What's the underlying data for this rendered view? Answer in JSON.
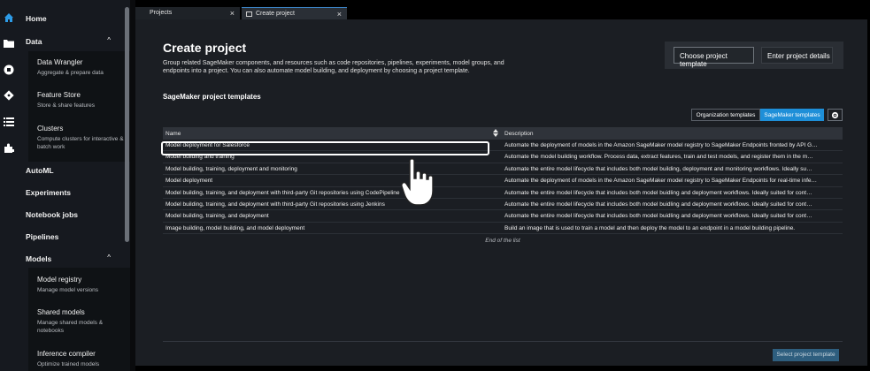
{
  "tabs": [
    {
      "label": "Projects",
      "close": "×"
    },
    {
      "label": "Create project",
      "close": "×"
    }
  ],
  "rail_icons": [
    "home-icon",
    "folder-icon",
    "circle-stop-icon",
    "git-icon",
    "list-icon",
    "puzzle-icon"
  ],
  "sidebar": {
    "home": "Home",
    "data": {
      "label": "Data",
      "chevron": "^"
    },
    "data_items": [
      {
        "title": "Data Wrangler",
        "desc": "Aggregate & prepare data"
      },
      {
        "title": "Feature Store",
        "desc": "Store & share features"
      },
      {
        "title": "Clusters",
        "desc": "Compute clusters for interactive & batch work"
      }
    ],
    "automl": "AutoML",
    "experiments": "Experiments",
    "notebook_jobs": "Notebook jobs",
    "pipelines": "Pipelines",
    "models": {
      "label": "Models",
      "chevron": "^"
    },
    "model_items": [
      {
        "title": "Model registry",
        "desc": "Manage model versions"
      },
      {
        "title": "Shared models",
        "desc": "Manage shared models & notebooks"
      },
      {
        "title": "Inference compiler",
        "desc": "Optimize trained models"
      }
    ]
  },
  "main": {
    "title": "Create project",
    "description": "Group related SageMaker components, and resources such as code repositories, pipelines, experiments, model groups, and endpoints into a project. You can also automate model building, and deployment by choosing a project template.",
    "steps": [
      "Choose project template",
      "Enter project details"
    ],
    "section_title": "SageMaker project templates",
    "toggle": {
      "org": "Organization templates",
      "sm": "SageMaker templates"
    },
    "table": {
      "col_name": "Name",
      "col_desc": "Description",
      "rows": [
        {
          "name": "Model deployment for Salesforce",
          "desc": "Automate the deployment of models in the Amazon SageMaker model registry to SageMaker Endpoints fronted by API G…"
        },
        {
          "name": "Model building and training",
          "desc": "Automate the model building workflow. Process data, extract features, train and test models, and register them in the m…"
        },
        {
          "name": "Model building, training, deployment and monitoring",
          "desc": "Automate the entire model lifecycle that includes both model building, deployment and monitoring workflows. Ideally su…"
        },
        {
          "name": "Model deployment",
          "desc": "Automate the deployment of models in the Amazon SageMaker model registry to SageMaker Endpoints for real-time infe…"
        },
        {
          "name": "Model building, training, and deployment with third-party Git repositories using CodePipeline",
          "desc": "Automate the entire model lifecycle that includes both model buidling and deployment workflows. Ideally suited for cont…"
        },
        {
          "name": "Model building, training, and deployment with third-party Git repositories using Jenkins",
          "desc": "Automate the entire model lifecycle that includes both model buidling and deployment workflows. Ideally suited for cont…"
        },
        {
          "name": "Model building, training, and deployment",
          "desc": "Automate the entire model lifecycle that includes both model buidling and deployment workflows. Ideally suited for cont…"
        },
        {
          "name": "Image building, model building, and model deployment",
          "desc": "Build an image that is used to train a model and then deploy the model to an endpoint in a model building pipeline."
        }
      ],
      "end": "End of the list"
    },
    "select_button": "Select project template"
  }
}
